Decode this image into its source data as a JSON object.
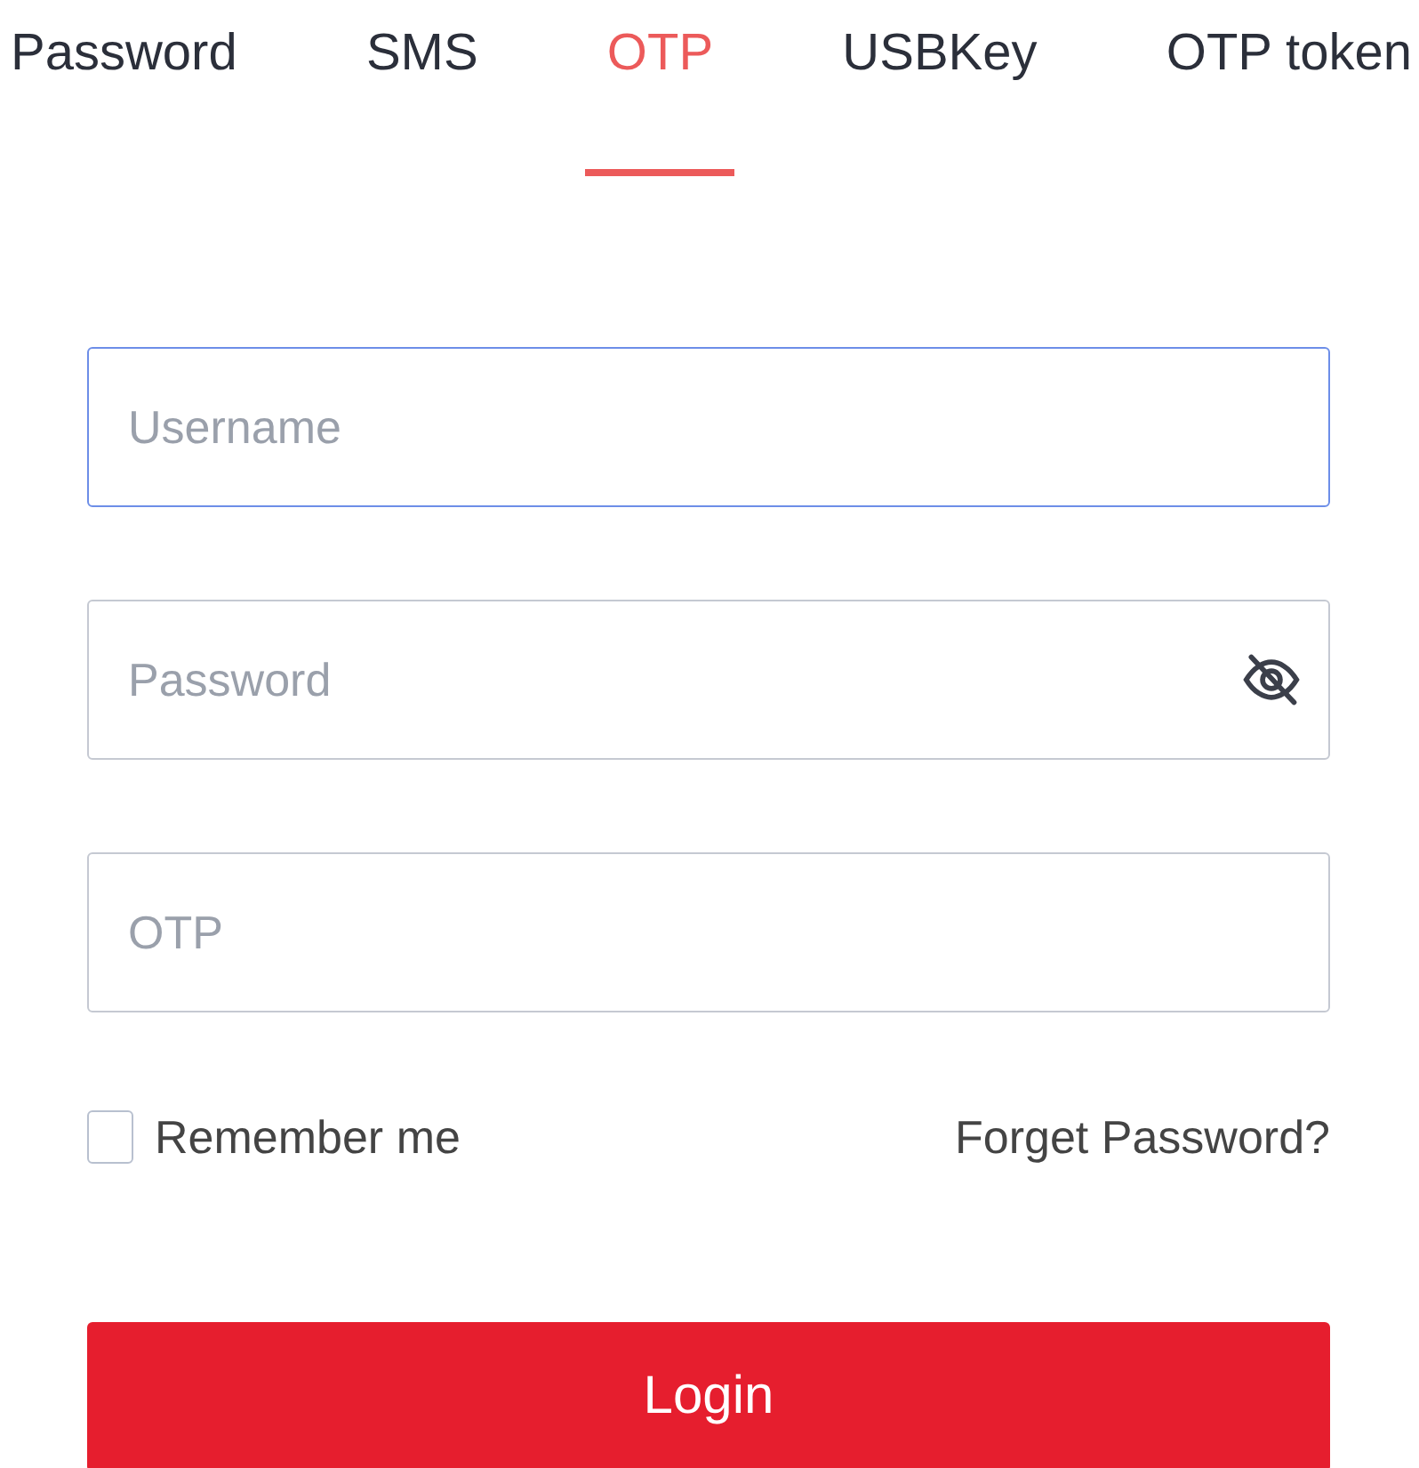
{
  "tabs": [
    {
      "label": "Password",
      "selected": false
    },
    {
      "label": "SMS",
      "selected": false
    },
    {
      "label": "OTP",
      "selected": true
    },
    {
      "label": "USBKey",
      "selected": false
    },
    {
      "label": "OTP token",
      "selected": false
    }
  ],
  "fields": [
    {
      "placeholder": "Username",
      "kind": "text",
      "focused": true
    },
    {
      "placeholder": "Password",
      "kind": "password",
      "focused": false
    },
    {
      "placeholder": "OTP",
      "kind": "text",
      "focused": false
    }
  ],
  "remember": {
    "label": "Remember me",
    "checked": false
  },
  "forgot_link": "Forget Password?",
  "login_button": "Login"
}
